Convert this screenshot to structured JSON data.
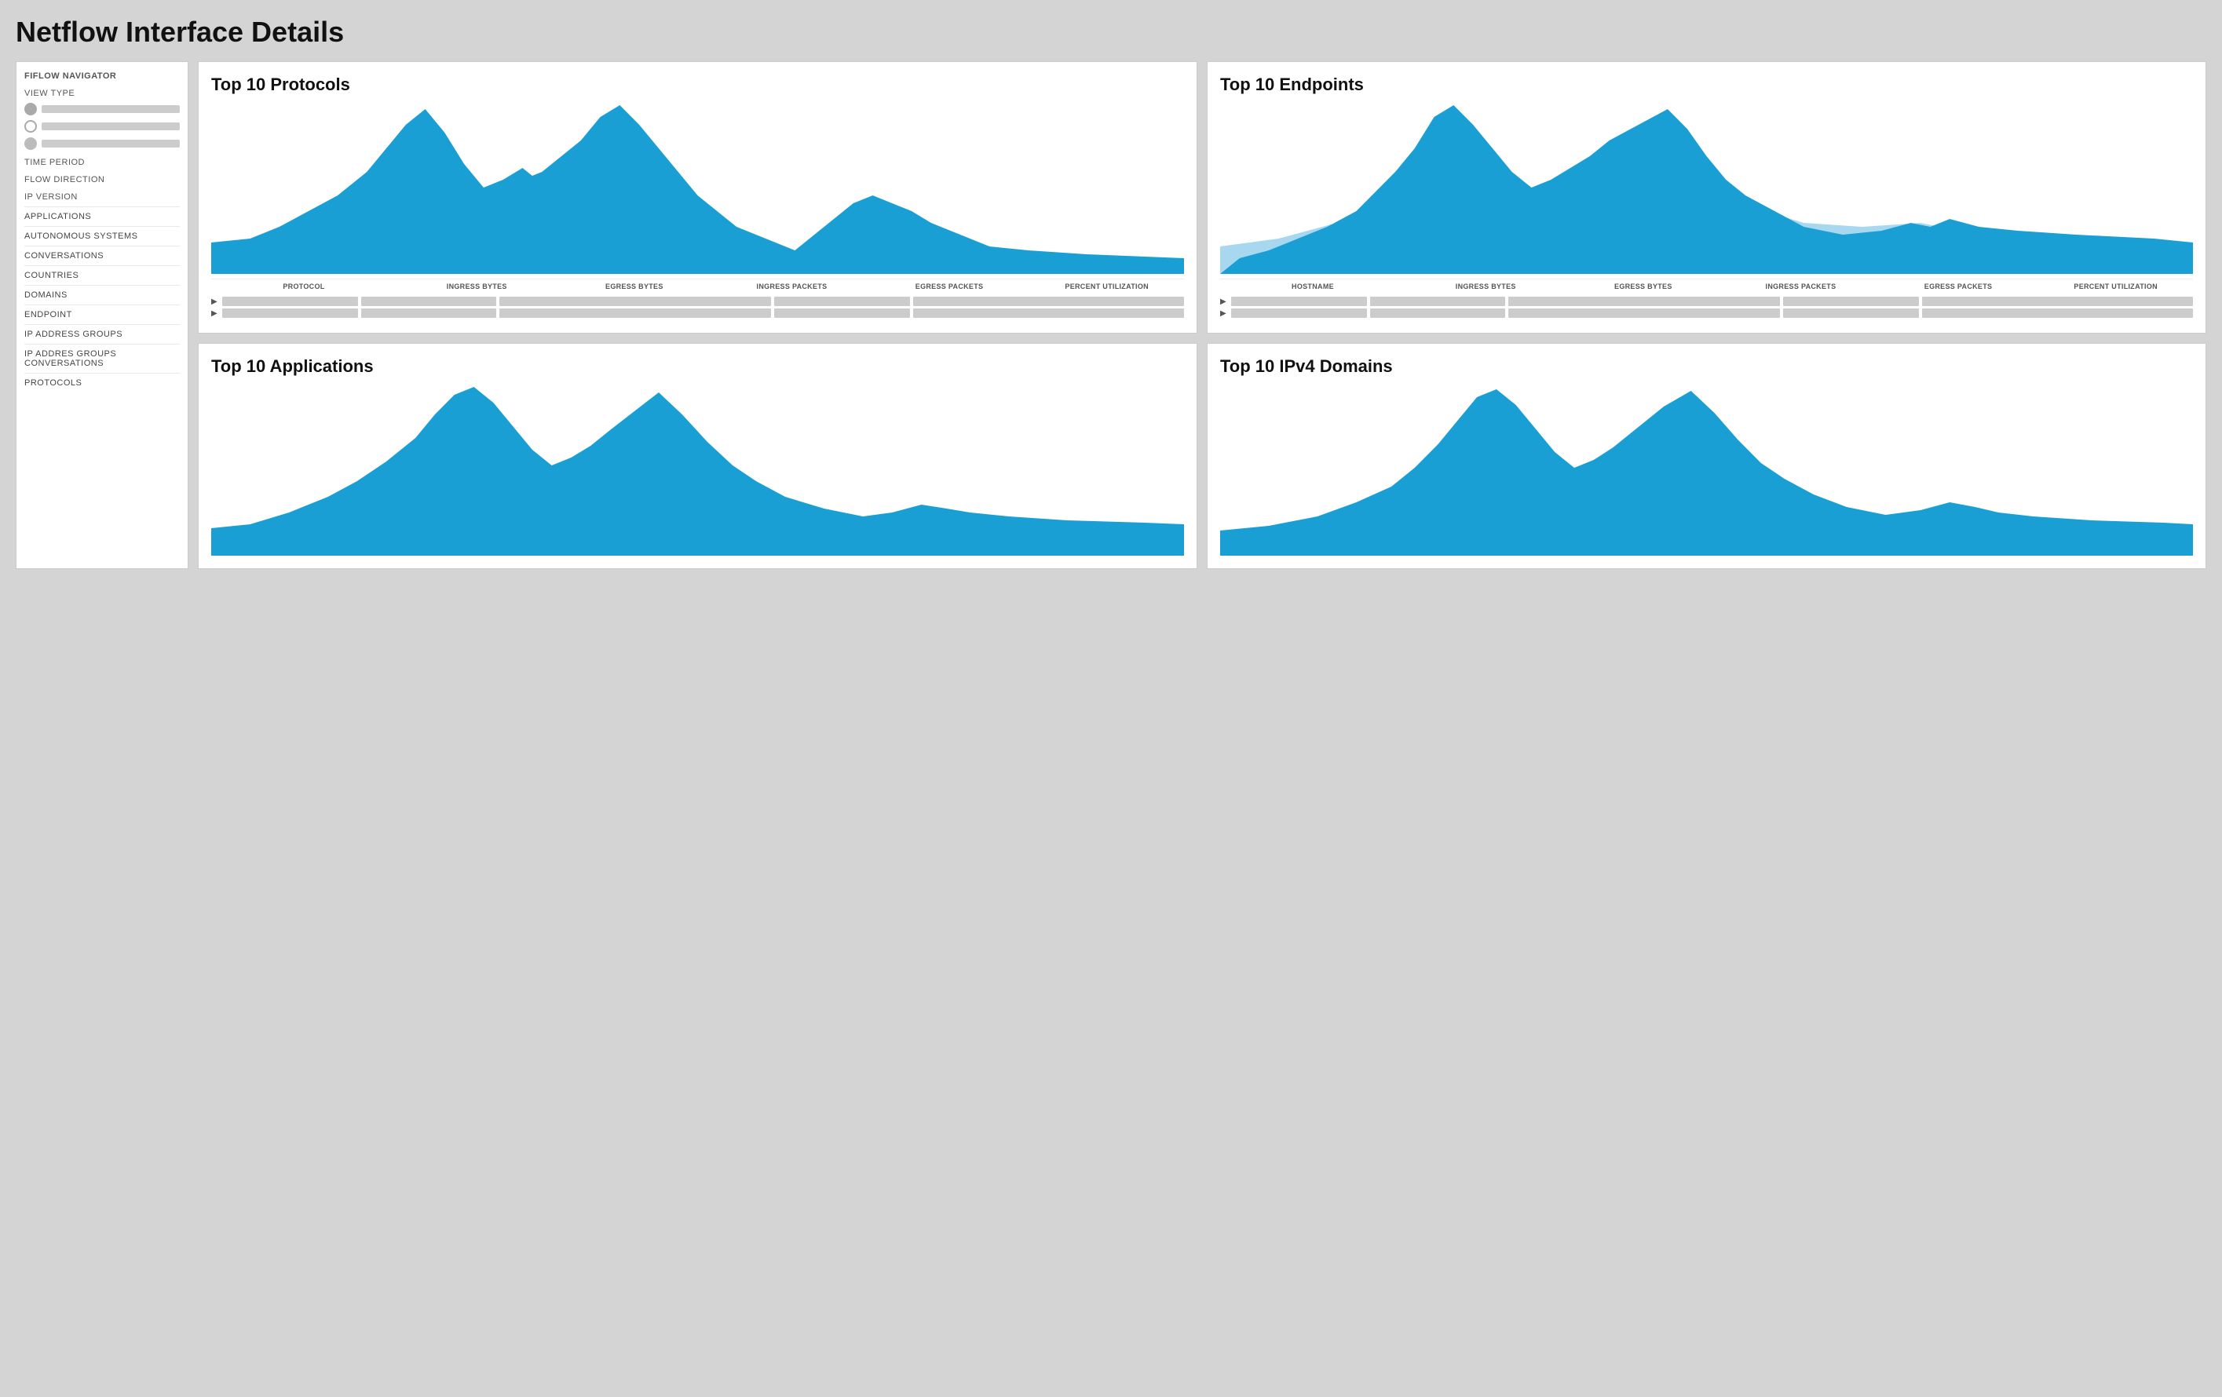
{
  "page": {
    "title": "Netflow Interface Details"
  },
  "sidebar": {
    "title": "FIFLOW NAVIGATOR",
    "view_type_label": "VIEW TYPE",
    "view_options": [
      {
        "type": "filled"
      },
      {
        "type": "empty"
      },
      {
        "type": "filled2"
      }
    ],
    "time_period_label": "TIME PERIOD",
    "flow_direction_label": "FLOW DIRECTION",
    "ip_version_label": "IP VERSION",
    "nav_items": [
      "APPLICATIONS",
      "AUTONOMOUS SYSTEMS",
      "CONVERSATIONS",
      "COUNTRIES",
      "DOMAINS",
      "ENDPOINT",
      "IP ADDRESS GROUPS",
      "IP ADDRES GROUPS CONVERSATIONS",
      "PROTOCOLS"
    ]
  },
  "panels": {
    "protocols": {
      "title": "Top 10 Protocols",
      "columns": [
        "PROTOCOL",
        "INGRESS BYTES",
        "EGRESS BYTES",
        "INGRESS PACKETS",
        "EGRESS PACKETS",
        "PERCENT UTILIZATION"
      ]
    },
    "endpoints": {
      "title": "Top 10 Endpoints",
      "columns": [
        "HOSTNAME",
        "INGRESS BYTES",
        "EGRESS BYTES",
        "INGRESS PACKETS",
        "EGRESS PACKETS",
        "PERCENT UTILIZATION"
      ]
    },
    "applications": {
      "title": "Top 10 Applications"
    },
    "ipv4domains": {
      "title": "Top 10 IPv4 Domains"
    }
  }
}
